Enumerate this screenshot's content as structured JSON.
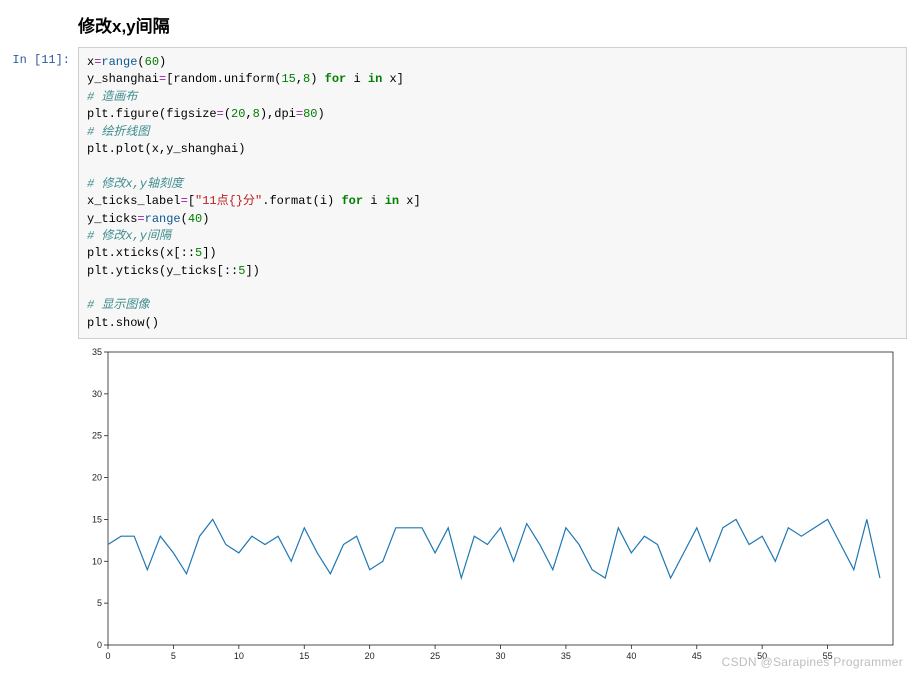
{
  "heading": "修改x,y间隔",
  "prompt": "In  [11]:",
  "code": {
    "l1a": "x",
    "l1b": "=",
    "l1c": "range",
    "l1d": "(",
    "l1e": "60",
    "l1f": ")",
    "l2a": "y_shanghai",
    "l2b": "=",
    "l2c": "[random.uniform(",
    "l2d": "15",
    "l2e": ",",
    "l2f": "8",
    "l2g": ") ",
    "l2h": "for",
    "l2i": " i ",
    "l2j": "in",
    "l2k": " x]",
    "l3": "# 造画布",
    "l4a": "plt.figure(figsize",
    "l4b": "=",
    "l4c": "(",
    "l4d": "20",
    "l4e": ",",
    "l4f": "8",
    "l4g": "),dpi",
    "l4h": "=",
    "l4i": "80",
    "l4j": ")",
    "l5": "# 绘折线图",
    "l6": "plt.plot(x,y_shanghai)",
    "l7": "",
    "l8": "# 修改x,y轴刻度",
    "l9a": "x_ticks_label",
    "l9b": "=",
    "l9c": "[",
    "l9d": "\"11点{}分\"",
    "l9e": ".format(i) ",
    "l9f": "for",
    "l9g": " i ",
    "l9h": "in",
    "l9i": " x]",
    "l10a": "y_ticks",
    "l10b": "=",
    "l10c": "range",
    "l10d": "(",
    "l10e": "40",
    "l10f": ")",
    "l11": "# 修改x,y间隔",
    "l12a": "plt.xticks(x[::",
    "l12b": "5",
    "l12c": "])",
    "l13a": "plt.yticks(y_ticks[::",
    "l13b": "5",
    "l13c": "])",
    "l14": "",
    "l15": "# 显示图像",
    "l16": "plt.show()"
  },
  "watermark": "CSDN @Sarapines Programmer",
  "chart_data": {
    "type": "line",
    "title": "",
    "xlabel": "",
    "ylabel": "",
    "xlim": [
      0,
      60
    ],
    "ylim": [
      0,
      35
    ],
    "x_ticks": [
      0,
      5,
      10,
      15,
      20,
      25,
      30,
      35,
      40,
      45,
      50,
      55
    ],
    "y_ticks": [
      0,
      5,
      10,
      15,
      20,
      25,
      30,
      35
    ],
    "x": [
      0,
      1,
      2,
      3,
      4,
      5,
      6,
      7,
      8,
      9,
      10,
      11,
      12,
      13,
      14,
      15,
      16,
      17,
      18,
      19,
      20,
      21,
      22,
      23,
      24,
      25,
      26,
      27,
      28,
      29,
      30,
      31,
      32,
      33,
      34,
      35,
      36,
      37,
      38,
      39,
      40,
      41,
      42,
      43,
      44,
      45,
      46,
      47,
      48,
      49,
      50,
      51,
      52,
      53,
      54,
      55,
      56,
      57,
      58,
      59
    ],
    "values": [
      12,
      13,
      13,
      9,
      13,
      11,
      8.5,
      13,
      15,
      12,
      11,
      13,
      12,
      13,
      10,
      14,
      11,
      8.5,
      12,
      13,
      9,
      10,
      14,
      14,
      14,
      11,
      14,
      8,
      13,
      12,
      14,
      10,
      14.5,
      12,
      9,
      14,
      12,
      9,
      8,
      14,
      11,
      13,
      12,
      8,
      11,
      14,
      10,
      14,
      15,
      12,
      13,
      10,
      14,
      13,
      14,
      15,
      12,
      9,
      15,
      8
    ]
  }
}
